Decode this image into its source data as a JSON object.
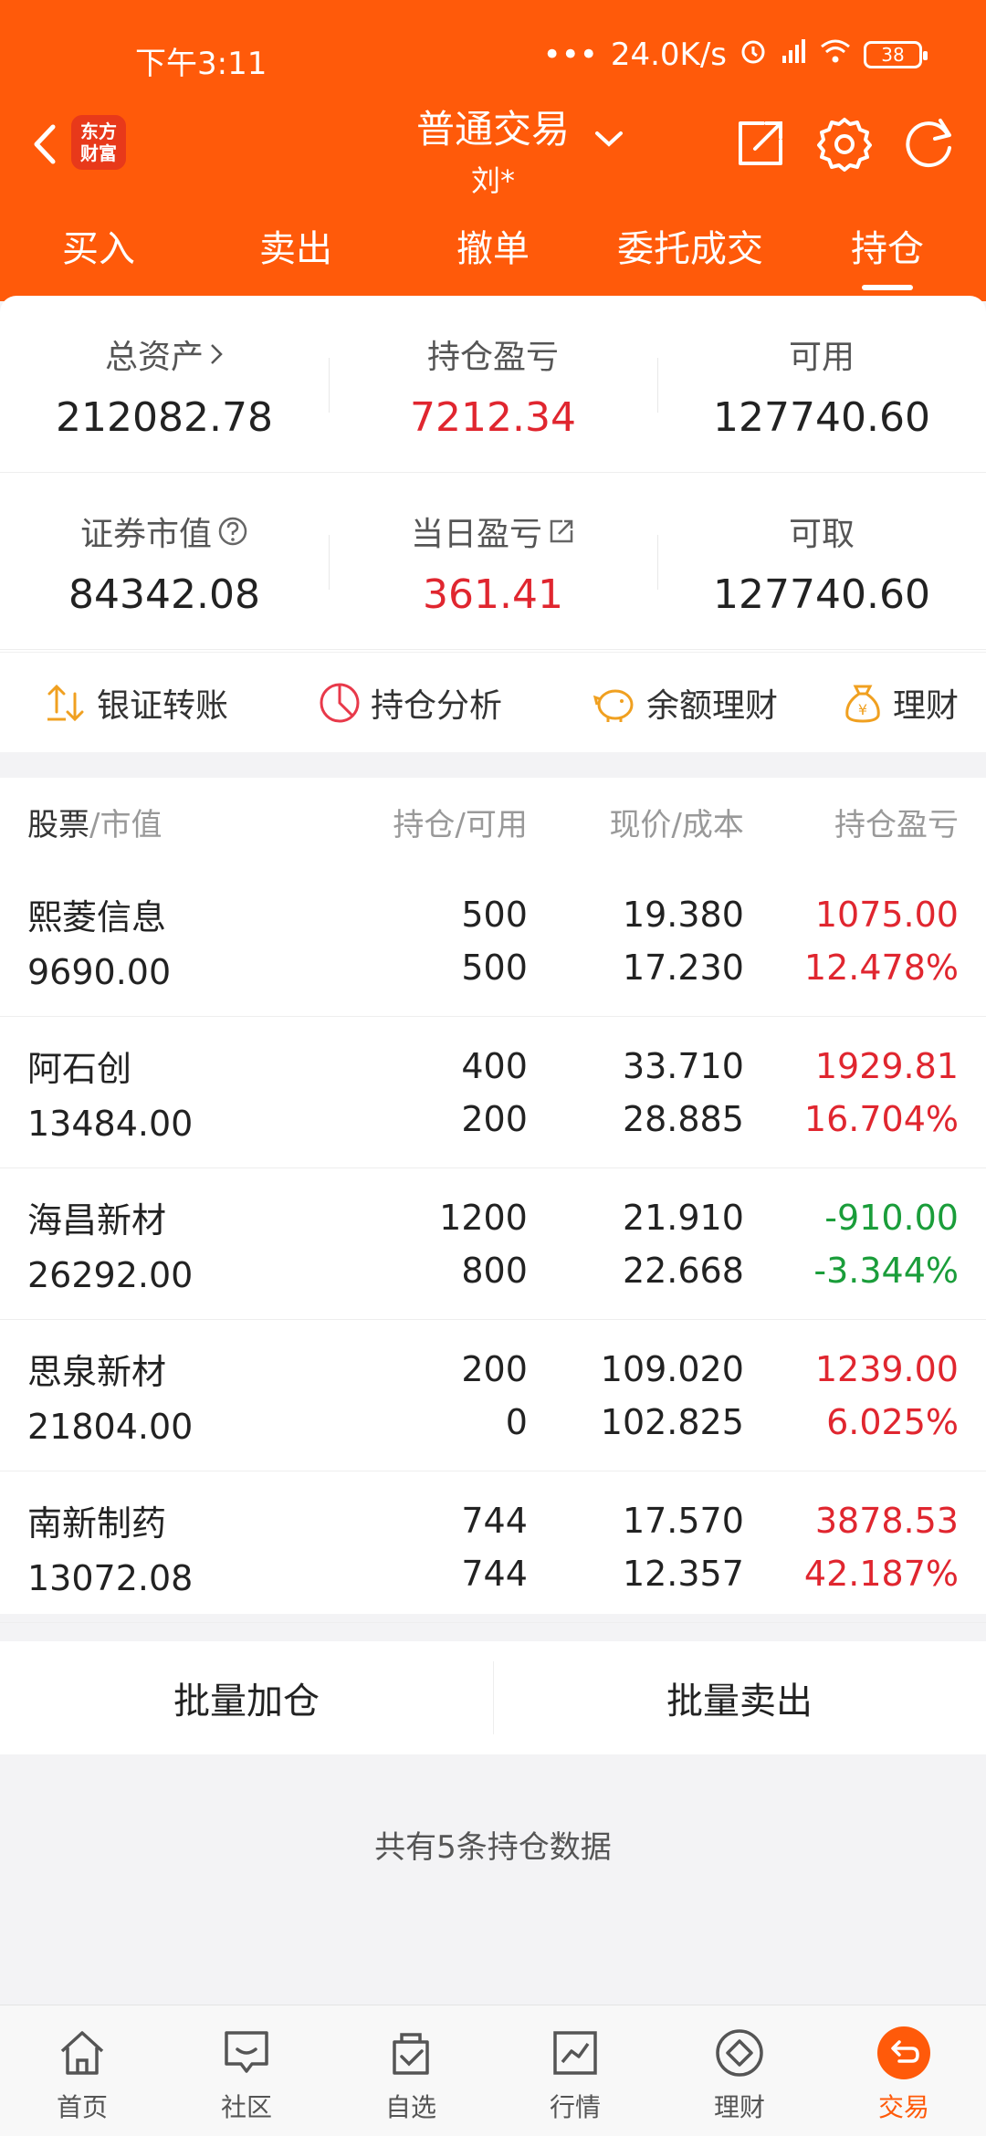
{
  "status_bar": {
    "time": "下午3:11",
    "network_speed": "24.0K/s",
    "battery": "38"
  },
  "header": {
    "logo_text_top": "东方",
    "logo_text_bottom": "财富",
    "title": "普通交易",
    "account": "刘*"
  },
  "tabs": [
    {
      "label": "买入"
    },
    {
      "label": "卖出"
    },
    {
      "label": "撤单"
    },
    {
      "label": "委托成交"
    },
    {
      "label": "持仓"
    }
  ],
  "summary": {
    "total_assets": {
      "label": "总资产",
      "value": "212082.78"
    },
    "position_pnl": {
      "label": "持仓盈亏",
      "value": "7212.34"
    },
    "available": {
      "label": "可用",
      "value": "127740.60"
    },
    "market_value": {
      "label": "证券市值",
      "value": "84342.08"
    },
    "daily_pnl": {
      "label": "当日盈亏",
      "value": "361.41"
    },
    "withdrawable": {
      "label": "可取",
      "value": "127740.60"
    }
  },
  "quick_actions": [
    {
      "label": "银证转账",
      "icon": "transfer-icon"
    },
    {
      "label": "持仓分析",
      "icon": "pie-chart-icon"
    },
    {
      "label": "余额理财",
      "icon": "piggy-bank-icon"
    },
    {
      "label": "理财",
      "icon": "money-bag-icon"
    }
  ],
  "table": {
    "headers": {
      "stock": "股票",
      "market_value": "/市值",
      "position": "持仓/可用",
      "price": "现价/成本",
      "pnl": "持仓盈亏"
    },
    "rows": [
      {
        "name": "熙菱信息",
        "value": "9690.00",
        "hold": "500",
        "avail": "500",
        "price": "19.380",
        "cost": "17.230",
        "pnl": "1075.00",
        "pnl_pct": "12.478%"
      },
      {
        "name": "阿石创",
        "value": "13484.00",
        "hold": "400",
        "avail": "200",
        "price": "33.710",
        "cost": "28.885",
        "pnl": "1929.81",
        "pnl_pct": "16.704%"
      },
      {
        "name": "海昌新材",
        "value": "26292.00",
        "hold": "1200",
        "avail": "800",
        "price": "21.910",
        "cost": "22.668",
        "pnl": "-910.00",
        "pnl_pct": "-3.344%"
      },
      {
        "name": "思泉新材",
        "value": "21804.00",
        "hold": "200",
        "avail": "0",
        "price": "109.020",
        "cost": "102.825",
        "pnl": "1239.00",
        "pnl_pct": "6.025%"
      },
      {
        "name": "南新制药",
        "value": "13072.08",
        "hold": "744",
        "avail": "744",
        "price": "17.570",
        "cost": "12.357",
        "pnl": "3878.53",
        "pnl_pct": "42.187%"
      }
    ]
  },
  "batch": {
    "add_label": "批量加仓",
    "sell_label": "批量卖出"
  },
  "footer_text": "共有5条持仓数据",
  "bottom_nav": [
    {
      "label": "首页",
      "icon": "home-icon"
    },
    {
      "label": "社区",
      "icon": "community-icon"
    },
    {
      "label": "自选",
      "icon": "watchlist-icon"
    },
    {
      "label": "行情",
      "icon": "market-icon"
    },
    {
      "label": "理财",
      "icon": "wealth-icon"
    },
    {
      "label": "交易",
      "icon": "trade-icon"
    }
  ],
  "colors": {
    "brand": "#ff5a0a",
    "profit": "#e0262f",
    "loss": "#1a9d3a"
  }
}
